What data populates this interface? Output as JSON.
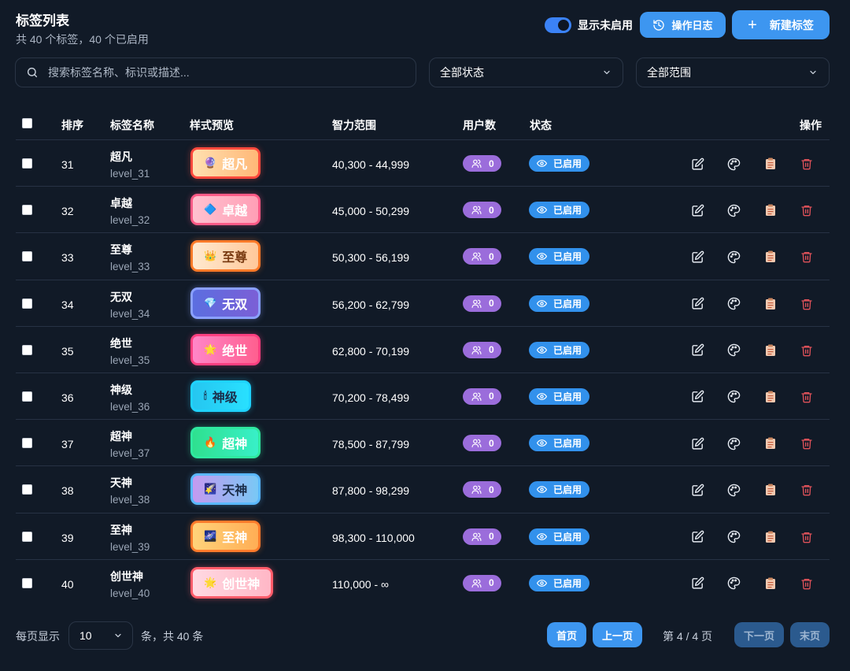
{
  "header": {
    "title": "标签列表",
    "subtitle": "共 40 个标签，40 个已启用",
    "toggle_label": "显示未启用",
    "toggle_on": true,
    "log_button": "操作日志",
    "new_button": "新建标签"
  },
  "filters": {
    "search_placeholder": "搜索标签名称、标识或描述...",
    "status_select": "全部状态",
    "scope_select": "全部范围"
  },
  "table": {
    "headers": {
      "sort": "排序",
      "name": "标签名称",
      "preview": "样式预览",
      "range": "智力范围",
      "users": "用户数",
      "status": "状态",
      "actions": "操作"
    },
    "rows": [
      {
        "sort": "31",
        "name": "超凡",
        "key": "level_31",
        "icon": "🔮",
        "badge_bg": "linear-gradient(90deg,#ffe0b0,#ffb877)",
        "badge_border": "#ff4a3d",
        "badge_text": "#ffffff",
        "range": "40,300 - 44,999",
        "users": "0",
        "status": "已启用"
      },
      {
        "sort": "32",
        "name": "卓越",
        "key": "level_32",
        "icon": "🔷",
        "badge_bg": "linear-gradient(90deg,#ffc1cf,#ff9fb6)",
        "badge_border": "#ff5a86",
        "badge_text": "#ffffff",
        "range": "45,000 - 50,299",
        "users": "0",
        "status": "已启用"
      },
      {
        "sort": "33",
        "name": "至尊",
        "key": "level_33",
        "icon": "👑",
        "badge_bg": "linear-gradient(90deg,#ffe9cf,#ffc89a)",
        "badge_border": "#ff7a28",
        "badge_text": "#7a3b12",
        "range": "50,300 - 56,199",
        "users": "0",
        "status": "已启用"
      },
      {
        "sort": "34",
        "name": "无双",
        "key": "level_34",
        "icon": "💎",
        "badge_bg": "linear-gradient(90deg,#5b6ee0,#7b5fd6)",
        "badge_border": "#8aa0ff",
        "badge_text": "#ffffff",
        "range": "56,200 - 62,799",
        "users": "0",
        "status": "已启用"
      },
      {
        "sort": "35",
        "name": "绝世",
        "key": "level_35",
        "icon": "🌟",
        "badge_bg": "linear-gradient(90deg,#ff86c8,#ff5f8f)",
        "badge_border": "#ff3f80",
        "badge_text": "#ffffff",
        "range": "62,800 - 70,199",
        "users": "0",
        "status": "已启用"
      },
      {
        "sort": "36",
        "name": "神级",
        "key": "level_36",
        "icon": "🕯",
        "badge_bg": "linear-gradient(90deg,#26c6f0,#28e0ff)",
        "badge_border": "#1fd3ff",
        "badge_text": "#1b2e4a",
        "range": "70,200 - 78,499",
        "users": "0",
        "status": "已启用"
      },
      {
        "sort": "37",
        "name": "超神",
        "key": "level_37",
        "icon": "🔥",
        "badge_bg": "linear-gradient(90deg,#2fe08f,#38f0c8)",
        "badge_border": "#2fe9a0",
        "badge_text": "#ffffff",
        "range": "78,500 - 87,799",
        "users": "0",
        "status": "已启用"
      },
      {
        "sort": "38",
        "name": "天神",
        "key": "level_38",
        "icon": "🌠",
        "badge_bg": "linear-gradient(90deg,#c49af0,#79c8f5)",
        "badge_border": "#5ab8ff",
        "badge_text": "#1b2e4a",
        "range": "87,800 - 98,299",
        "users": "0",
        "status": "已启用"
      },
      {
        "sort": "39",
        "name": "至神",
        "key": "level_39",
        "icon": "🌌",
        "badge_bg": "linear-gradient(90deg,#ffd37a,#ffae55)",
        "badge_border": "#ff7b2b",
        "badge_text": "#ffffff",
        "range": "98,300 - 110,000",
        "users": "0",
        "status": "已启用"
      },
      {
        "sort": "40",
        "name": "创世神",
        "key": "level_40",
        "icon": "🌟",
        "badge_bg": "linear-gradient(90deg,#ffd9e2,#ffb7c6)",
        "badge_border": "#ff5c6a",
        "badge_text": "#ffffff",
        "range": "110,000 - ∞",
        "users": "0",
        "status": "已启用"
      }
    ]
  },
  "pagination": {
    "per_page_label": "每页显示",
    "per_page_value": "10",
    "total_text": "条，共 40 条",
    "first": "首页",
    "prev": "上一页",
    "info": "第 4 / 4 页",
    "next": "下一页",
    "last": "末页"
  },
  "colors": {
    "background": "#111a27",
    "accent": "#3d96f0",
    "users_badge": "#9b6ddb",
    "status_badge": "#3291ec",
    "delete": "#e0525a"
  },
  "icons": {
    "toggle": "toggle-switch",
    "log": "history-icon",
    "new": "plus-icon",
    "search": "search-icon",
    "select": "chevron-down-icon",
    "users": "users-icon",
    "status": "eye-icon",
    "edit": "edit-icon",
    "palette": "palette-icon",
    "copy": "clipboard-icon",
    "delete": "trash-icon"
  }
}
